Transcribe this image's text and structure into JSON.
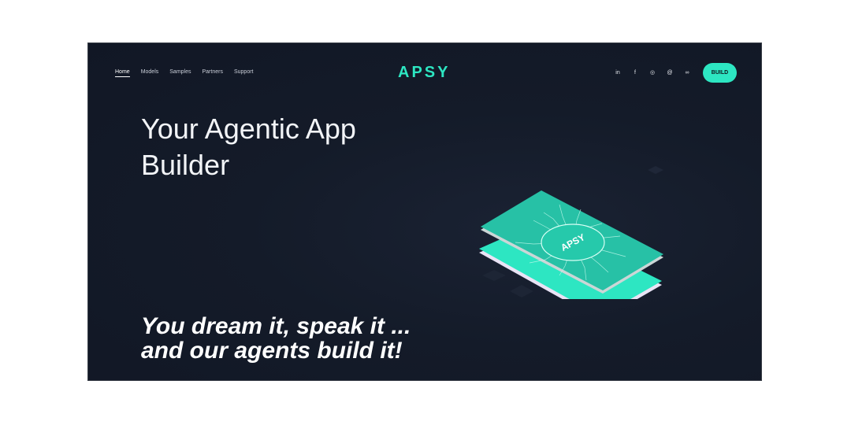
{
  "nav": {
    "items": [
      {
        "label": "Home",
        "active": true
      },
      {
        "label": "Models",
        "active": false
      },
      {
        "label": "Samples",
        "active": false
      },
      {
        "label": "Partners",
        "active": false
      },
      {
        "label": "Support",
        "active": false
      }
    ]
  },
  "logo": {
    "text": "APSY"
  },
  "socials": [
    {
      "name": "linkedin-icon",
      "glyph": "in"
    },
    {
      "name": "facebook-icon",
      "glyph": "f"
    },
    {
      "name": "instagram-icon",
      "glyph": "◎"
    },
    {
      "name": "threads-icon",
      "glyph": "@"
    },
    {
      "name": "link-icon",
      "glyph": "∞"
    }
  ],
  "build_button": {
    "label": "BUILD"
  },
  "hero": {
    "headline": "Your Agentic App\nBuilder",
    "tagline": "You dream it, speak it ...\nand our agents build it!"
  },
  "illustration": {
    "chip_label": "APSY"
  },
  "colors": {
    "accent": "#2de6c2",
    "background": "#141b29",
    "text": "#f2f4f7"
  }
}
